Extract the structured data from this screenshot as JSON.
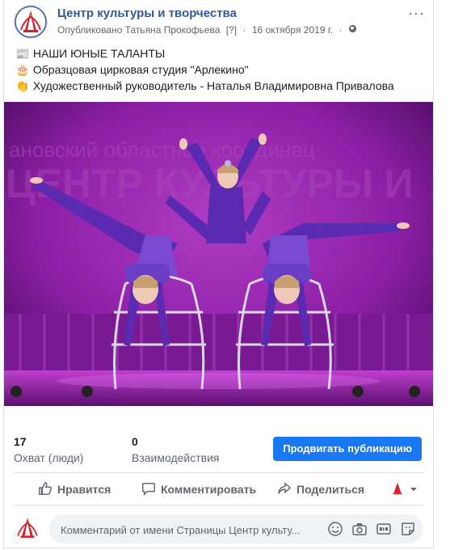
{
  "post": {
    "page_name": "Центр культуры и творчества",
    "published_by": "Опубликовано Татьяна Прокофьева",
    "help_mark": "[?]",
    "date": "16 октября 2019 г.",
    "more": "···",
    "lines": [
      {
        "icon": "newspaper-icon",
        "emoji": "📰",
        "text": "НАШИ ЮНЫЕ ТАЛАНТЫ"
      },
      {
        "icon": "cake-icon",
        "emoji": "🎂",
        "text": "Образцовая цирковая студия \"Арлекино\""
      },
      {
        "icon": "clapping-hand-icon",
        "emoji": "👏",
        "text": "Художественный руководитель - Наталья Владимировна Привалова"
      }
    ]
  },
  "photo": {
    "background_text_line1": "ановский областной координац",
    "background_text_line2": "ЦЕНТР КУЛЬТУРЫ И"
  },
  "stats": {
    "reach_value": "17",
    "reach_label": "Охват (люди)",
    "engagement_value": "0",
    "engagement_label": "Взаимодействия",
    "promote_label": "Продвигать публикацию"
  },
  "actions": {
    "like": "Нравится",
    "comment": "Комментировать",
    "share": "Поделиться"
  },
  "comment": {
    "placeholder": "Комментарий от имени Страницы Центр культу..."
  },
  "colors": {
    "link_blue": "#365899",
    "button_blue": "#1877f2",
    "stage_purple": "#8c1fa6",
    "costume_purple": "#5a2bb0",
    "brand_red": "#d2232a"
  }
}
